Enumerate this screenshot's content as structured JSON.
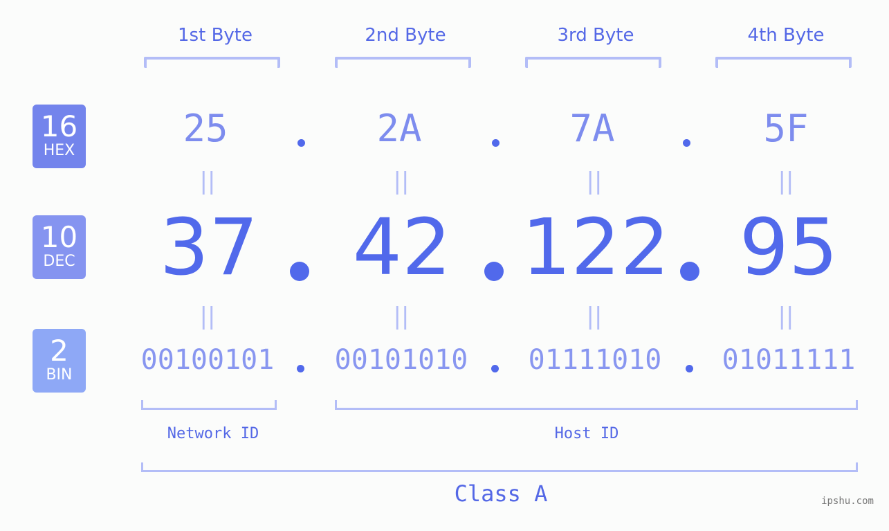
{
  "badges": [
    {
      "number": "16",
      "label": "HEX",
      "color": "#7384ec"
    },
    {
      "number": "10",
      "label": "DEC",
      "color": "#8594f0"
    },
    {
      "number": "2",
      "label": "BIN",
      "color": "#8ea8f6"
    }
  ],
  "byte_headers": [
    "1st Byte",
    "2nd Byte",
    "3rd Byte",
    "4th Byte"
  ],
  "hex": [
    "25",
    "2A",
    "7A",
    "5F"
  ],
  "dec": [
    "37",
    "42",
    "122",
    "95"
  ],
  "bin": [
    "00100101",
    "00101010",
    "01111010",
    "01011111"
  ],
  "separator": ".",
  "equals_glyph": "||",
  "network_label": "Network ID",
  "host_label": "Host ID",
  "class_label": "Class A",
  "watermark": "ipshu.com",
  "colors": {
    "primary": "#5169eb",
    "bracket": "#b3bdf7",
    "hex_text": "#7d8cee",
    "bin_text": "#8896f0"
  }
}
